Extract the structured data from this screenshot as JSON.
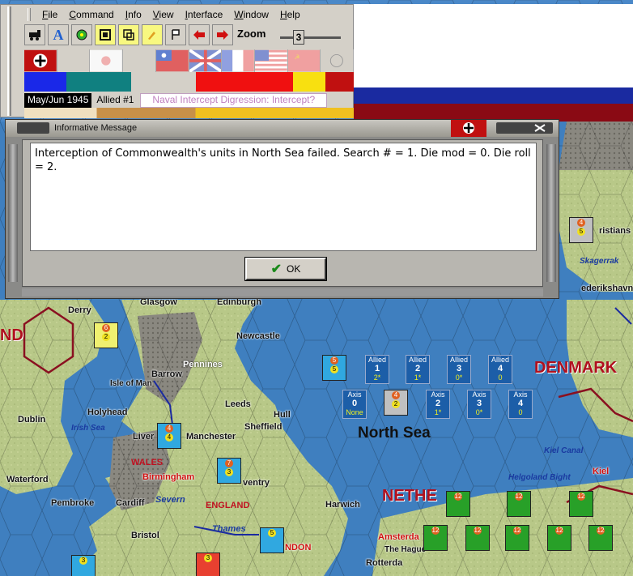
{
  "menu": {
    "items": [
      "File",
      "Command",
      "Info",
      "View",
      "Interface",
      "Window",
      "Help"
    ]
  },
  "toolbar": {
    "zoom_label": "Zoom",
    "zoom_value": "3",
    "tools": [
      "train-icon",
      "font-icon",
      "gear-icon",
      "grid-icon",
      "layers-icon",
      "paint-icon",
      "flag-icon",
      "arrow-left-icon",
      "arrow-right-icon"
    ]
  },
  "status": {
    "date": "May/Jun 1945",
    "side": "Allied #1",
    "phase": "Naval Intercept Digression: Intercept?"
  },
  "dialog": {
    "title": "Informative Message",
    "message": "Interception of Commonwealth's units in North Sea failed.  Search # = 1.  Die mod = 0.  Die roll = 2.",
    "ok_label": "OK"
  },
  "map": {
    "countries": [
      "ND",
      "DENMARK",
      "NETHE"
    ],
    "regions": [
      "WALES",
      "ENGLAND"
    ],
    "seas": [
      "Irish Sea",
      "Skagerrak",
      "Severn",
      "Thames",
      "Kiel Canal",
      "Helgoland Bight"
    ],
    "big_sea": "North Sea",
    "cities": [
      "Derry",
      "Glasgow",
      "Edinburgh",
      "Newcastle",
      "Pennines",
      "Barrow",
      "Isle of Man",
      "Holyhead",
      "Dublin",
      "Leeds",
      "Hull",
      "Liver",
      "Manchester",
      "Sheffield",
      "Waterford",
      "Birmingham",
      "Pembroke",
      "Cardiff",
      "Bristol",
      "Harwich",
      "ristians",
      "ederikshavn",
      "Kiel",
      "Amsterda",
      "The Hague",
      "Rotterda",
      "ventry",
      "NDON",
      "Pennin"
    ],
    "ocean_boxes": {
      "allied": [
        {
          "label": "Allied",
          "num": "1",
          "sub": "2*"
        },
        {
          "label": "Allied",
          "num": "2",
          "sub": "1*"
        },
        {
          "label": "Allied",
          "num": "3",
          "sub": "0*"
        },
        {
          "label": "Allied",
          "num": "4",
          "sub": "0"
        }
      ],
      "axis": [
        {
          "label": "Axis",
          "num": "0",
          "sub": "None"
        },
        {
          "label": "Axis",
          "num": "2",
          "sub": "1*"
        },
        {
          "label": "Axis",
          "num": "3",
          "sub": "0*"
        },
        {
          "label": "Axis",
          "num": "4",
          "sub": "0"
        }
      ]
    }
  }
}
